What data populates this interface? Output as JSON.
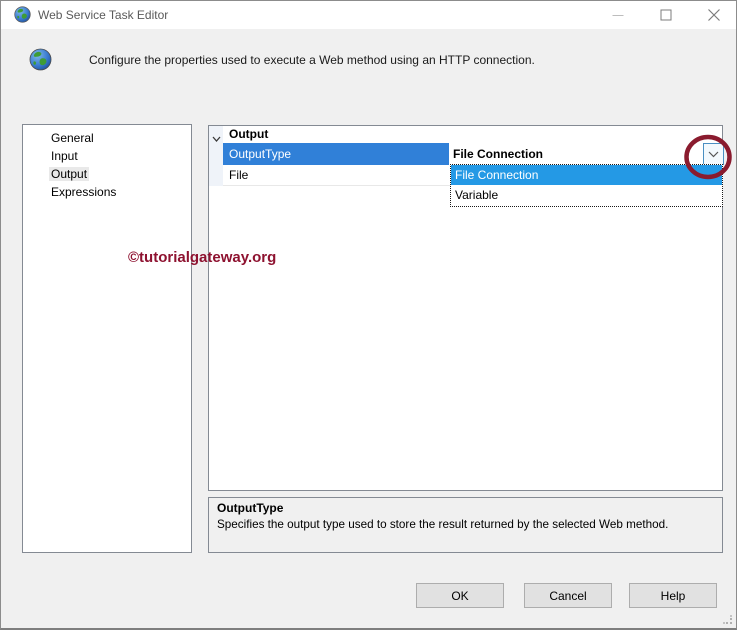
{
  "window": {
    "title": "Web Service Task Editor"
  },
  "banner": {
    "description": "Configure the properties used to execute a Web method using an HTTP connection."
  },
  "sidebar": {
    "items": [
      {
        "label": "General",
        "selected": false
      },
      {
        "label": "Input",
        "selected": false
      },
      {
        "label": "Output",
        "selected": true
      },
      {
        "label": "Expressions",
        "selected": false
      }
    ]
  },
  "grid": {
    "group_label": "Output",
    "rows": [
      {
        "name": "OutputType",
        "value": "File Connection",
        "selected": true
      },
      {
        "name": "File",
        "value": "",
        "selected": false
      }
    ],
    "dropdown": {
      "options": [
        {
          "label": "File Connection",
          "highlighted": true
        },
        {
          "label": "Variable",
          "highlighted": false
        }
      ]
    }
  },
  "help_panel": {
    "title": "OutputType",
    "description": "Specifies the output type used to store the result returned by the selected Web method."
  },
  "watermark": {
    "text": "©tutorialgateway.org",
    "color": "#8e1230"
  },
  "annotation": {
    "shape": "ellipse",
    "color": "#8a1b2e"
  },
  "footer": {
    "buttons": [
      {
        "label": "OK"
      },
      {
        "label": "Cancel"
      },
      {
        "label": "Help"
      }
    ]
  },
  "icons": {
    "titlebar": [
      "globe-icon",
      "minimize-icon",
      "maximize-icon",
      "close-icon"
    ],
    "grid": [
      "chevron-down-icon"
    ],
    "colors": {
      "row_selection": "#3080d8",
      "list_highlight": "#2499e5",
      "combo_border": "#4a8fc2",
      "dialog_bg": "#f0f0f0"
    }
  }
}
